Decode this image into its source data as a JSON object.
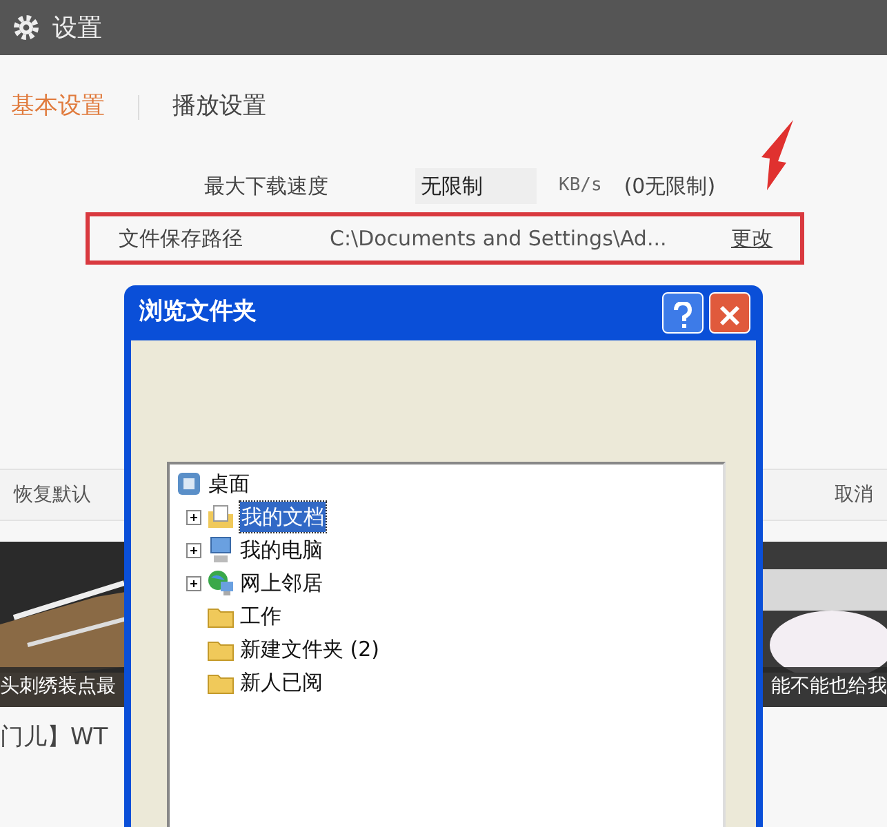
{
  "window": {
    "title": "设置"
  },
  "tabs": [
    {
      "label": "基本设置",
      "selected": true
    },
    {
      "label": "播放设置",
      "selected": false
    }
  ],
  "settings": [
    {
      "label": "最大下载速度",
      "value": "无限制",
      "unit": "KB/s",
      "hint": "(0无限制)",
      "highlighted": false
    },
    {
      "label": "文件保存路径",
      "value": "C:\\Documents and Settings\\Ad...",
      "link": "更改",
      "highlighted": true
    }
  ],
  "footer_buttons": [
    "恢复默认",
    "取消"
  ],
  "feed": [
    {
      "kind": "picture",
      "caption": "头刺绣装点最"
    },
    {
      "kind": "picture",
      "caption": "能不能也给我"
    }
  ],
  "feed_text": "门儿】WT",
  "dialog": {
    "title": "浏览文件夹",
    "tree": {
      "label": "桌面",
      "kind": "desktop",
      "children": [
        {
          "label": "我的文档",
          "kind": "documents",
          "expandable": true,
          "selected": true
        },
        {
          "label": "我的电脑",
          "kind": "computer",
          "expandable": true,
          "selected": false
        },
        {
          "label": "网上邻居",
          "kind": "network",
          "expandable": true,
          "selected": false
        },
        {
          "label": "工作",
          "kind": "folder",
          "expandable": false,
          "selected": false
        },
        {
          "label": "新建文件夹 (2)",
          "kind": "folder",
          "expandable": false,
          "selected": false
        },
        {
          "label": "新人已阅",
          "kind": "folder",
          "expandable": false,
          "selected": false
        }
      ]
    }
  }
}
